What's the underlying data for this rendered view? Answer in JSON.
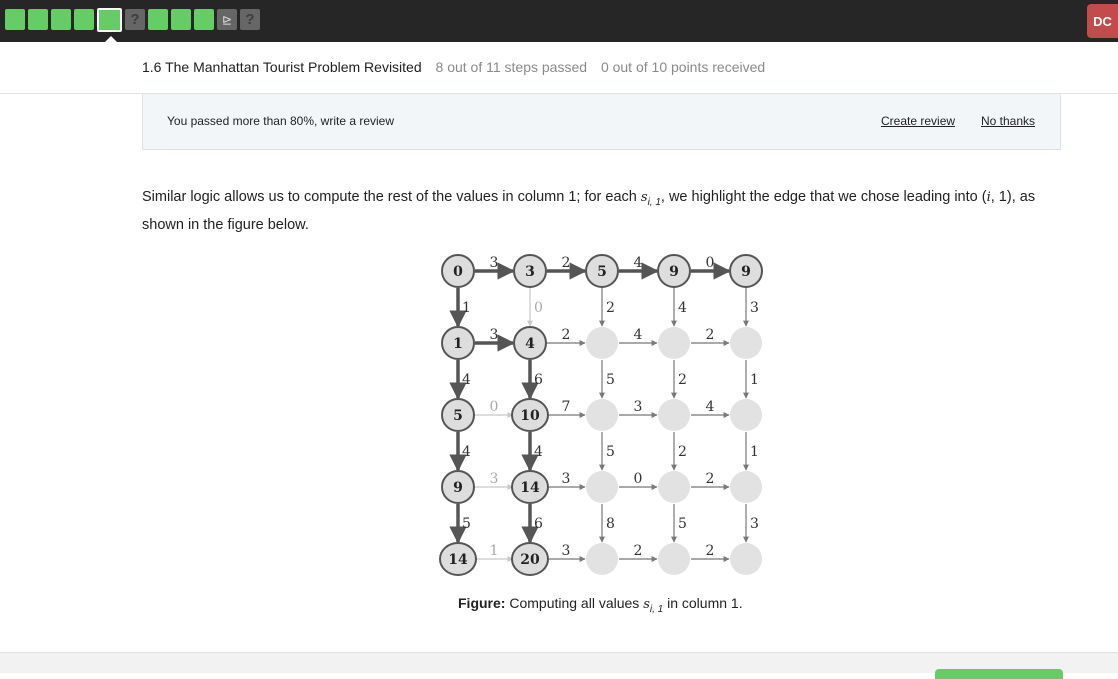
{
  "topbar": {
    "steps": [
      {
        "state": "passed"
      },
      {
        "state": "passed"
      },
      {
        "state": "passed"
      },
      {
        "state": "passed"
      },
      {
        "state": "current"
      },
      {
        "state": "unknown",
        "symbol": "?"
      },
      {
        "state": "passed"
      },
      {
        "state": "passed"
      },
      {
        "state": "passed"
      },
      {
        "state": "code",
        "symbol": "⊵"
      },
      {
        "state": "unknown",
        "symbol": "?"
      }
    ],
    "user_initials": "DC"
  },
  "header": {
    "lesson_title": "1.6 The Manhattan Tourist Problem Revisited",
    "steps_status": "8 out of 11 steps passed",
    "points_status": "0 out of 10 points  received"
  },
  "review_banner": {
    "message": "You passed more than 80%, write a review",
    "create_label": "Create review",
    "dismiss_label": "No thanks"
  },
  "content": {
    "para_start": "Similar logic allows us to compute the rest of the values in column 1; for each ",
    "var_s": "s",
    "var_sub": "i, 1",
    "para_mid": ", we highlight the edge that we chose leading into (",
    "var_i": "i",
    "para_end": ", 1), as shown in the figure below."
  },
  "figure": {
    "node_values": [
      [
        "0",
        "3",
        "5",
        "9",
        "9"
      ],
      [
        "1",
        "4",
        "",
        "",
        ""
      ],
      [
        "5",
        "10",
        "",
        "",
        ""
      ],
      [
        "9",
        "14",
        "",
        "",
        ""
      ],
      [
        "14",
        "20",
        "",
        "",
        ""
      ]
    ],
    "right_weights": [
      [
        "3",
        "2",
        "4",
        "0"
      ],
      [
        "3",
        "2",
        "4",
        "2"
      ],
      [
        "0",
        "7",
        "3",
        "4"
      ],
      [
        "3",
        "3",
        "0",
        "2"
      ],
      [
        "1",
        "3",
        "2",
        "2"
      ]
    ],
    "down_weights": [
      [
        "1",
        "0",
        "2",
        "4",
        "3"
      ],
      [
        "4",
        "6",
        "5",
        "2",
        "1"
      ],
      [
        "4",
        "4",
        "5",
        "2",
        "1"
      ],
      [
        "5",
        "6",
        "8",
        "5",
        "3"
      ]
    ],
    "highlighted_right": [
      [
        0,
        0
      ],
      [
        0,
        1
      ],
      [
        0,
        2
      ],
      [
        0,
        3
      ],
      [
        1,
        0
      ]
    ],
    "dimmed_right": [
      [
        2,
        0
      ],
      [
        3,
        0
      ],
      [
        4,
        0
      ]
    ],
    "highlighted_down": [
      [
        0,
        0
      ],
      [
        1,
        0
      ],
      [
        2,
        0
      ],
      [
        3,
        0
      ],
      [
        1,
        1
      ],
      [
        2,
        1
      ],
      [
        3,
        1
      ]
    ],
    "dimmed_down": [
      [
        0,
        1
      ]
    ],
    "colors": {
      "highlight": "#555555",
      "normal": "#777777",
      "dimmed": "#c8c8c8",
      "node_fill_computed": "#dddddd",
      "node_fill_empty": "#e2e2e2"
    }
  },
  "caption": {
    "label": "Figure:",
    "text_start": " Computing all values ",
    "var_s": "s",
    "var_sub": "i, 1",
    "text_end": " in column 1."
  }
}
